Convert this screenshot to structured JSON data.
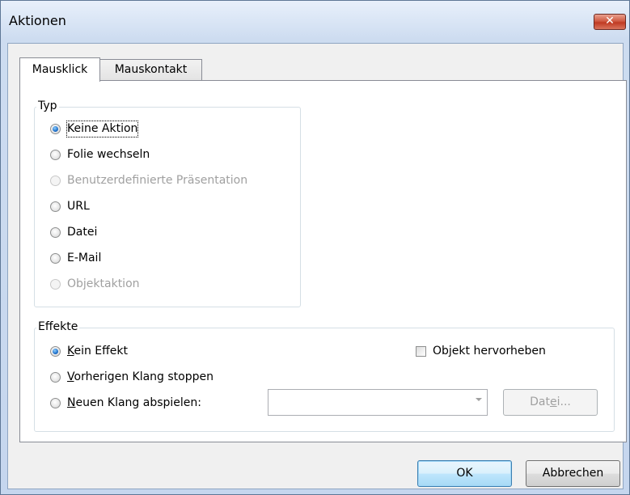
{
  "window": {
    "title": "Aktionen",
    "close_label": "✕"
  },
  "tabs": [
    {
      "label": "Mausklick",
      "active": true
    },
    {
      "label": "Mauskontakt",
      "active": false
    }
  ],
  "typ_group": {
    "label": "Typ",
    "options": [
      {
        "label": "Keine Aktion",
        "checked": true,
        "disabled": false
      },
      {
        "label": "Folie wechseln",
        "checked": false,
        "disabled": false
      },
      {
        "label": "Benutzerdefinierte Präsentation",
        "checked": false,
        "disabled": true
      },
      {
        "label": "URL",
        "checked": false,
        "disabled": false
      },
      {
        "label": "Datei",
        "checked": false,
        "disabled": false
      },
      {
        "label": "E-Mail",
        "checked": false,
        "disabled": false
      },
      {
        "label": "Objektaktion",
        "checked": false,
        "disabled": true
      }
    ]
  },
  "effekte_group": {
    "label": "Effekte",
    "options": [
      {
        "label_pre": "",
        "label_acc": "K",
        "label_post": "ein Effekt",
        "checked": true
      },
      {
        "label_pre": "",
        "label_acc": "V",
        "label_post": "orherigen Klang stoppen",
        "checked": false
      },
      {
        "label_pre": "",
        "label_acc": "N",
        "label_post": "euen Klang abspielen:",
        "checked": false
      }
    ],
    "highlight_label": "Objekt hervorheben",
    "highlight_checked": false,
    "sound_select_value": "",
    "file_button": {
      "pre": "Dat",
      "acc": "e",
      "post": "i..."
    }
  },
  "footer": {
    "ok_label": "OK",
    "cancel_label": "Abbrechen"
  }
}
